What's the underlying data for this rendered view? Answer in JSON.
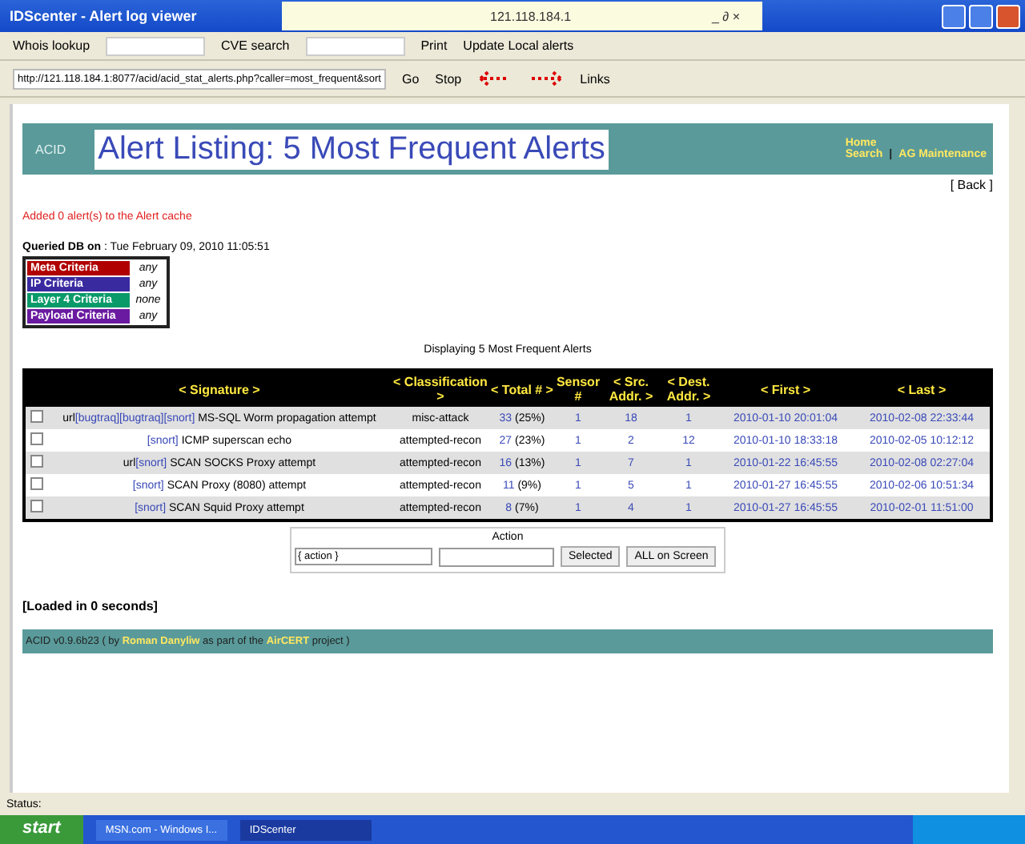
{
  "window": {
    "title": "IDScenter - Alert log viewer",
    "host": "121.118.184.1",
    "controls": "_ ∂ ×"
  },
  "toolbar": {
    "whois": "Whois lookup",
    "cve": "CVE search",
    "print": "Print",
    "update": "Update Local alerts"
  },
  "address": {
    "url": "http://121.118.184.1:8077/acid/acid_stat_alerts.php?caller=most_frequent&sort",
    "go": "Go",
    "stop": "Stop",
    "links": "Links"
  },
  "header": {
    "logo": "ACID",
    "title": "Alert Listing: 5 Most Frequent Alerts",
    "home": "Home",
    "search": "Search",
    "separator": "|",
    "maintenance": "AG Maintenance"
  },
  "back": "[ Back ]",
  "notice": "Added 0 alert(s) to the Alert cache",
  "queried": {
    "label": "Queried DB on",
    "value": " : Tue February 09, 2010 11:05:51"
  },
  "criteria": [
    {
      "name": "Meta Criteria",
      "value": "any",
      "color": "#b00000"
    },
    {
      "name": "IP Criteria",
      "value": "any",
      "color": "#3a2aa0"
    },
    {
      "name": "Layer 4 Criteria",
      "value": "none",
      "color": "#0a9a6a"
    },
    {
      "name": "Payload Criteria",
      "value": "any",
      "color": "#6a1aa0"
    }
  ],
  "caption": "Displaying 5 Most Frequent Alerts",
  "table": {
    "columns": [
      "< Signature >",
      "< Classification >",
      "< Total # >",
      "Sensor #",
      "< Src. Addr. >",
      "< Dest. Addr. >",
      "< First >",
      "< Last >"
    ],
    "rows": [
      {
        "checked": false,
        "prefix": "url",
        "refs": [
          "[bugtraq]",
          "[bugtraq]",
          "[snort]"
        ],
        "name": " MS-SQL Worm propagation attempt",
        "classification": "misc-attack",
        "total": "33",
        "pct": " (25%)",
        "sensor": "1",
        "src": "18",
        "dst": "1",
        "first": "2010-01-10 20:01:04",
        "last": "2010-02-08 22:33:44"
      },
      {
        "checked": false,
        "prefix": "",
        "refs": [
          "[snort]"
        ],
        "name": " ICMP superscan echo",
        "classification": "attempted-recon",
        "total": "27",
        "pct": " (23%)",
        "sensor": "1",
        "src": "2",
        "dst": "12",
        "first": "2010-01-10 18:33:18",
        "last": "2010-02-05 10:12:12"
      },
      {
        "checked": false,
        "prefix": "url",
        "refs": [
          "[snort]"
        ],
        "name": " SCAN SOCKS Proxy attempt",
        "classification": "attempted-recon",
        "total": "16",
        "pct": " (13%)",
        "sensor": "1",
        "src": "7",
        "dst": "1",
        "first": "2010-01-22 16:45:55",
        "last": "2010-02-08 02:27:04"
      },
      {
        "checked": false,
        "prefix": "",
        "refs": [
          "[snort]"
        ],
        "name": " SCAN Proxy (8080) attempt",
        "classification": "attempted-recon",
        "total": "11",
        "pct": " (9%)",
        "sensor": "1",
        "src": "5",
        "dst": "1",
        "first": "2010-01-27 16:45:55",
        "last": "2010-02-06 10:51:34"
      },
      {
        "checked": false,
        "prefix": "",
        "refs": [
          "[snort]"
        ],
        "name": " SCAN Squid Proxy attempt",
        "classification": "attempted-recon",
        "total": "8",
        "pct": " (7%)",
        "sensor": "1",
        "src": "4",
        "dst": "1",
        "first": "2010-01-27 16:45:55",
        "last": "2010-02-01 11:51:00"
      }
    ]
  },
  "action": {
    "label": "Action",
    "select": "{ action }",
    "selected": "Selected",
    "all": "ALL on Screen"
  },
  "loaded": "[Loaded in 0 seconds]",
  "footer": {
    "prefix": "ACID v0.9.6b23 ( by ",
    "author": "Roman Danyliw",
    "middle": " as part of the ",
    "project": "AirCERT",
    "suffix": " project )"
  },
  "status": "Status:",
  "taskbar": {
    "start": "start",
    "tasks": [
      {
        "label": "MSN.com - Windows I...",
        "selected": false
      },
      {
        "label": "IDScenter",
        "selected": true
      }
    ]
  }
}
